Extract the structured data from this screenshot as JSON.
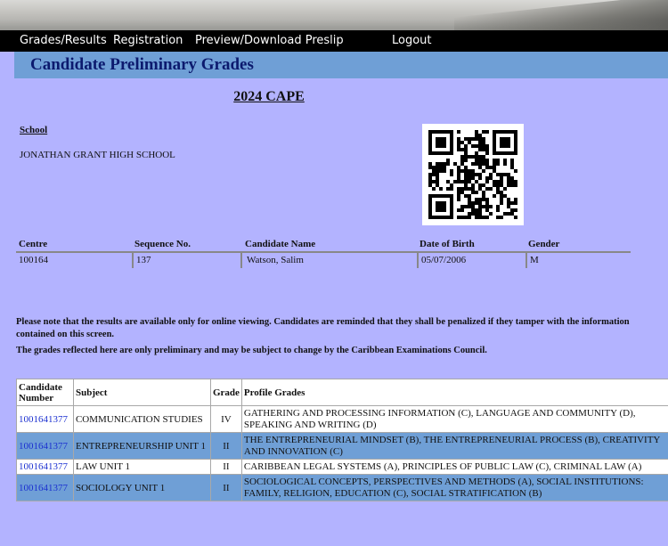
{
  "nav": {
    "items": [
      "Grades/Results",
      "Registration",
      "Preview/Download Preslip",
      "Logout"
    ]
  },
  "page_title": "Candidate Preliminary Grades",
  "exam_title": "2024 CAPE",
  "school": {
    "label": "School",
    "name": "JONATHAN GRANT HIGH SCHOOL"
  },
  "qr_icon": "qr-code",
  "candidate_info": {
    "headers": [
      "Centre",
      "Sequence No.",
      "Candidate Name",
      "Date of Birth",
      "Gender"
    ],
    "values": [
      "100164",
      "137",
      "Watson, Salim",
      "05/07/2006",
      "M"
    ]
  },
  "notices": [
    "Please note that the results are available only for online viewing. Candidates are reminded that they shall be penalized if they tamper with the information contained on this screen.",
    "The grades reflected here are only preliminary and may be subject to change by the Caribbean Examinations Council."
  ],
  "grades_table": {
    "headers": [
      "Candidate Number",
      "Subject",
      "Grade",
      "Profile Grades"
    ],
    "rows": [
      {
        "number": "1001641377",
        "subject": "COMMUNICATION STUDIES",
        "grade": "IV",
        "profile": "GATHERING AND PROCESSING INFORMATION (C), LANGUAGE AND COMMUNITY (D), SPEAKING AND WRITING (D)"
      },
      {
        "number": "1001641377",
        "subject": "ENTREPRENEURSHIP UNIT 1",
        "grade": "II",
        "profile": "THE ENTREPRENEURIAL MINDSET (B), THE ENTREPRENEURIAL PROCESS (B), CREATIVITY AND INNOVATION (C)"
      },
      {
        "number": "1001641377",
        "subject": "LAW UNIT 1",
        "grade": "II",
        "profile": "CARIBBEAN LEGAL SYSTEMS (A), PRINCIPLES OF PUBLIC LAW (C), CRIMINAL LAW (A)"
      },
      {
        "number": "1001641377",
        "subject": "SOCIOLOGY UNIT 1",
        "grade": "II",
        "profile": "SOCIOLOGICAL CONCEPTS, PERSPECTIVES AND METHODS (A), SOCIAL INSTITUTIONS: FAMILY, RELIGION, EDUCATION (C), SOCIAL STRATIFICATION (B)"
      }
    ]
  },
  "colors": {
    "page_background": "#b3b3ff",
    "heading_bar": "#6f9fd6",
    "title_text": "#0c1a6e",
    "link": "#1a2fd0"
  }
}
